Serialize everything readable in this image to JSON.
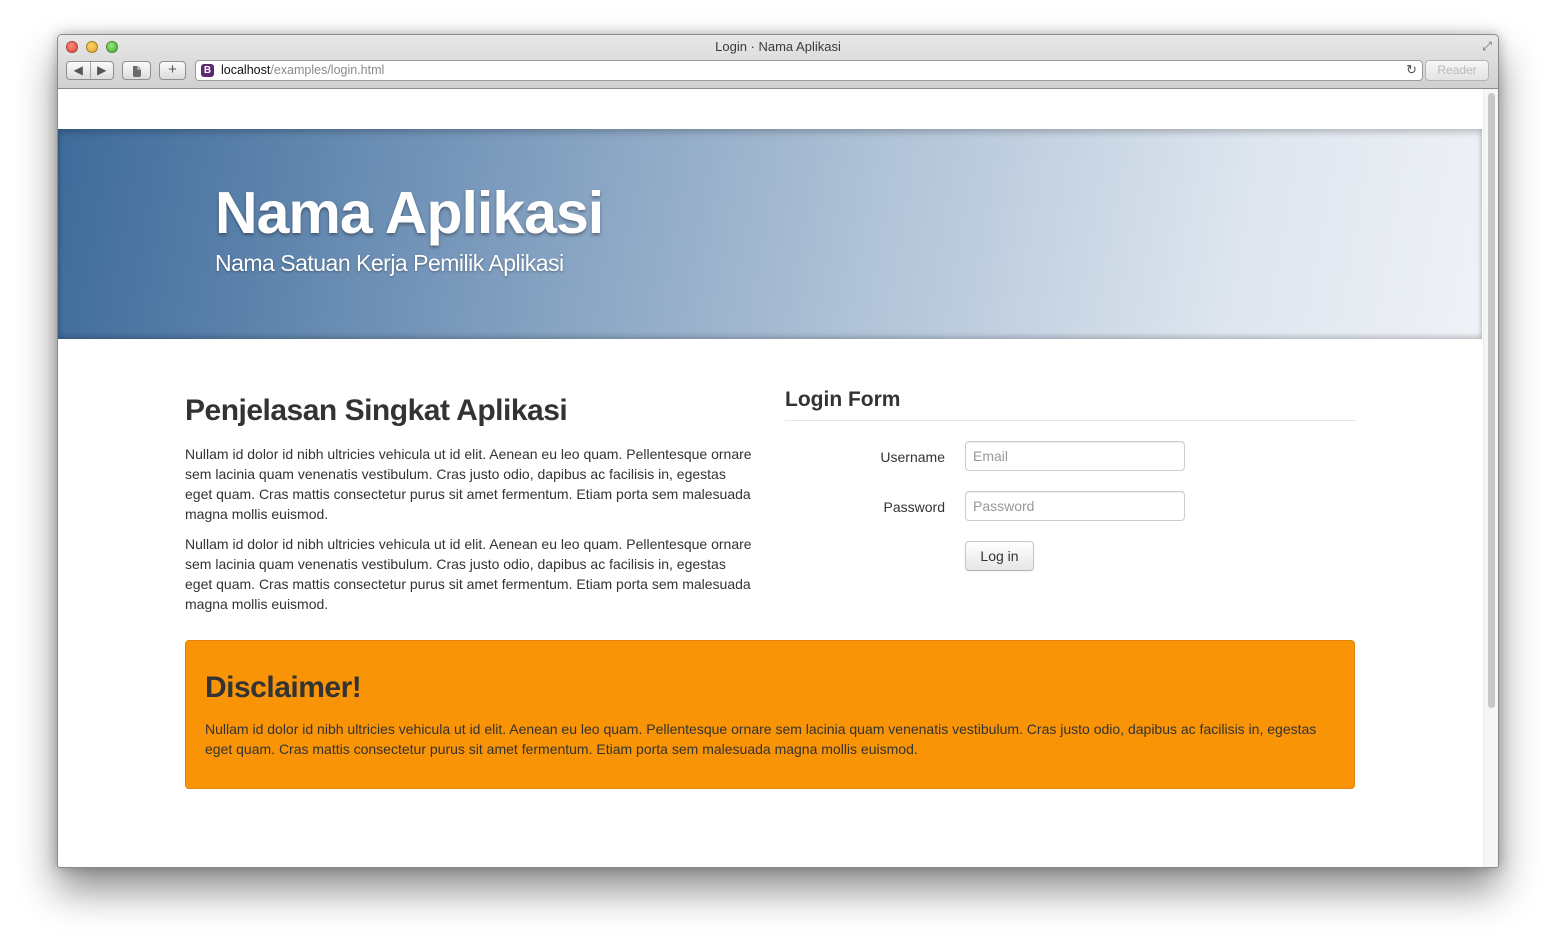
{
  "browser": {
    "window_title": "Login · Nama Aplikasi",
    "url_host": "localhost",
    "url_path": "/examples/login.html",
    "reader_label": "Reader",
    "favicon_letter": "B",
    "nav_back_glyph": "◀",
    "nav_forward_glyph": "▶",
    "add_glyph": "+",
    "reload_glyph": "↻",
    "fullscreen_glyph": "⤢"
  },
  "header": {
    "title": "Nama Aplikasi",
    "subtitle": "Nama Satuan Kerja Pemilik Aplikasi"
  },
  "intro": {
    "heading": "Penjelasan Singkat Aplikasi",
    "paragraphs": [
      "Nullam id dolor id nibh ultricies vehicula ut id elit. Aenean eu leo quam. Pellentesque ornare sem lacinia quam venenatis vestibulum. Cras justo odio, dapibus ac facilisis in, egestas eget quam. Cras mattis consectetur purus sit amet fermentum. Etiam porta sem malesuada magna mollis euismod.",
      "Nullam id dolor id nibh ultricies vehicula ut id elit. Aenean eu leo quam. Pellentesque ornare sem lacinia quam venenatis vestibulum. Cras justo odio, dapibus ac facilisis in, egestas eget quam. Cras mattis consectetur purus sit amet fermentum. Etiam porta sem malesuada magna mollis euismod."
    ]
  },
  "login_form": {
    "legend": "Login Form",
    "username_label": "Username",
    "username_placeholder": "Email",
    "username_value": "",
    "password_label": "Password",
    "password_placeholder": "Password",
    "password_value": "",
    "submit_label": "Log in"
  },
  "disclaimer": {
    "title": "Disclaimer!",
    "text": "Nullam id dolor id nibh ultricies vehicula ut id elit. Aenean eu leo quam. Pellentesque ornare sem lacinia quam venenatis vestibulum. Cras justo odio, dapibus ac facilisis in, egestas eget quam. Cras mattis consectetur purus sit amet fermentum. Etiam porta sem malesuada magna mollis euismod."
  },
  "colors": {
    "header_gradient_start": "#3e6a9a",
    "header_gradient_end": "#eff2f6",
    "disclaimer_bg": "#f89406",
    "text": "#333333"
  },
  "icons": {
    "close": "close-button-icon",
    "minimize": "minimize-button-icon",
    "zoom": "zoom-button-icon",
    "back": "back-arrow-icon",
    "forward": "forward-arrow-icon",
    "evernote": "evernote-icon",
    "add": "plus-icon",
    "favicon": "bootstrap-favicon-icon",
    "reload": "reload-icon",
    "fullscreen": "fullscreen-icon"
  }
}
